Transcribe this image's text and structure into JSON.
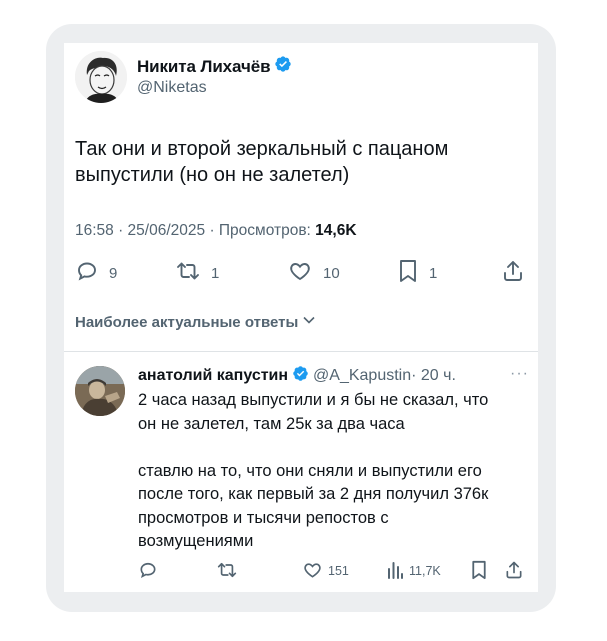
{
  "tweet": {
    "author_name": "Никита Лихачёв",
    "author_handle": "@Niketas",
    "text_lines": [
      "Так они и второй зеркальный с пацаном",
      "выпустили (но он не залетел)"
    ],
    "meta_time": "16:58 · 25/06/2025 · Просмотров: ",
    "meta_views": "14,6K",
    "actions": {
      "replies": "9",
      "retweets": "1",
      "likes": "10",
      "bookmarks": "1"
    },
    "icons": [
      "reply-icon",
      "retweet-icon",
      "like-icon",
      "bookmark-icon",
      "share-icon",
      "verified-badge-icon"
    ]
  },
  "sort": {
    "label": "Наиболее актуальные ответы"
  },
  "reply": {
    "author_name": "анатолий капустин",
    "author_handle": "@A_Kapustin",
    "time": "· 20 ч.",
    "more": "···",
    "paragraph1": [
      "2 часа назад выпустили и я бы не сказал, что",
      "он не залетел, там 25к за два часа"
    ],
    "paragraph2": [
      "ставлю на то, что они сняли и выпустили его",
      "после того, как первый за 2 дня получил 376к",
      "просмотров и тысячи репостов с",
      "возмущениями"
    ],
    "actions": {
      "replies": "",
      "retweets": "",
      "likes": "151",
      "views": "11,7K"
    },
    "icons": [
      "reply-icon",
      "retweet-icon",
      "like-icon",
      "analytics-icon",
      "bookmark-icon",
      "share-icon"
    ]
  },
  "colors": {
    "verified": "#1d9bf0",
    "secondary_text": "#536471",
    "frame_bg": "#eceef0"
  }
}
